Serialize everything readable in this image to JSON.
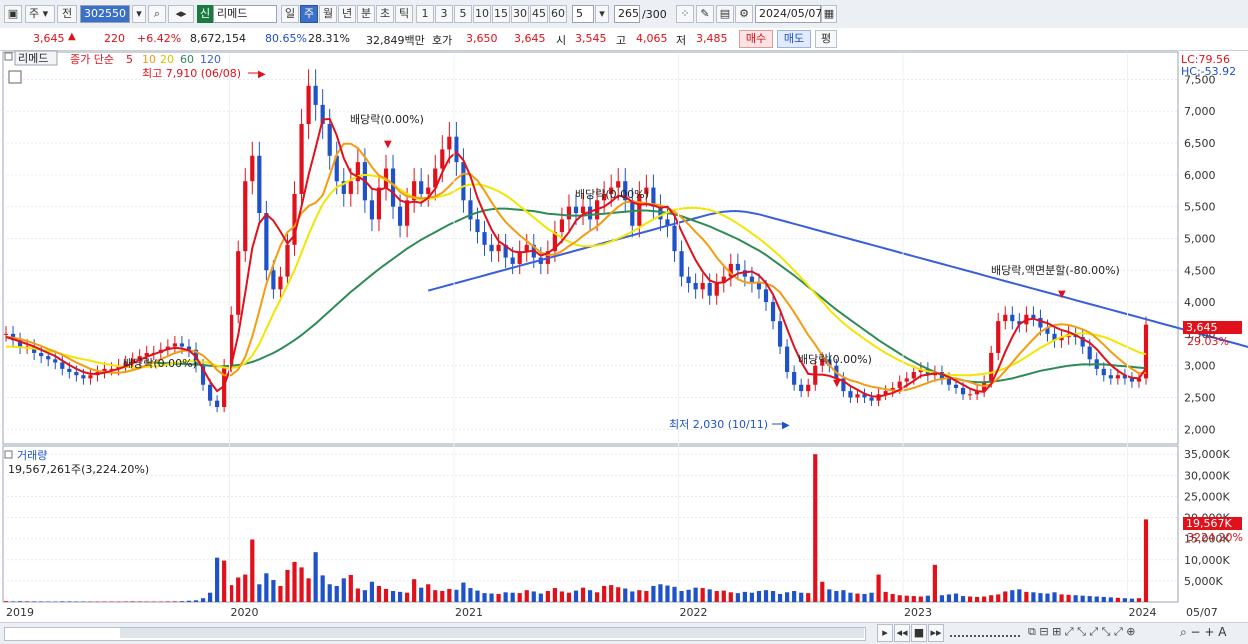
{
  "toolbar": {
    "period_select": "주",
    "prev_label": "전",
    "stock_code": "302550",
    "new_badge": "신",
    "stock_name": "리메드",
    "periods": [
      "일",
      "주",
      "월",
      "년",
      "분",
      "초",
      "틱"
    ],
    "active_period": "주",
    "intervals": [
      "1",
      "3",
      "5",
      "10",
      "15",
      "30",
      "45",
      "60"
    ],
    "interval_value": "5",
    "count_current": "265",
    "count_total": "/300",
    "date": "2024/05/07"
  },
  "quote": {
    "price": "3,645",
    "change": "220",
    "change_pct": "+6.42%",
    "volume": "8,672,154",
    "vol_ratio": "80.65%",
    "turnover_pct": "28.31%",
    "amount": "32,849백만",
    "bid_label": "호가",
    "ask_price": "3,650",
    "bid_price": "3,645",
    "open_label": "시",
    "open": "3,545",
    "high_label": "고",
    "high": "4,065",
    "low_label": "저",
    "low": "3,485",
    "buy_button": "매수",
    "sell_button": "매도",
    "eval_button": "평"
  },
  "price_panel": {
    "stock_tab": "리메드",
    "ma_legend_prefix": "종가 단순",
    "ma_periods": [
      "5",
      "10",
      "20",
      "60",
      "120"
    ],
    "lc_label": "LC:79.56",
    "hc_label": "HC:-53.92",
    "high_annotation": "최고 7,910 (06/08)",
    "low_annotation": "최저 2,030 (10/11)",
    "events": [
      "배당락(0.00%)",
      "배당락(0.00%)",
      "배당락(0.00%)",
      "배당락(0.00%)",
      "배당락,액면분할(-80.00%)"
    ],
    "current_price_tag": "3,645",
    "current_pct_tag": "29.03%"
  },
  "volume_panel": {
    "title": "거래량",
    "summary": "19,567,261주(3,224.20%)",
    "current_tag": "19,567K",
    "current_pct_tag": "3224.20%"
  },
  "colors": {
    "up": "#e0111b",
    "down": "#1f52c8",
    "ma5": "#e0111b",
    "ma10": "#f39c12",
    "ma20": "#f2e600",
    "ma60": "#2e8b57",
    "ma120": "#3a5fd9"
  },
  "chart_data": [
    {
      "type": "candlestick",
      "title": "리메드 (302550) 주봉",
      "x_labels": [
        "2019",
        "2020",
        "2021",
        "2022",
        "2023",
        "2024",
        "05/07"
      ],
      "ylim": [
        1800,
        7900
      ],
      "y_ticks": [
        2000,
        2500,
        3000,
        3500,
        4000,
        4500,
        5000,
        5500,
        6000,
        6500,
        7000,
        7500
      ],
      "y_tick_labels": [
        "2,000",
        "2,500",
        "3,000",
        "3,500",
        "4,000",
        "4,500",
        "5,000",
        "5,500",
        "6,000",
        "6,500",
        "7,000",
        "7,500"
      ],
      "close": [
        3500,
        3400,
        3300,
        3300,
        3200,
        3150,
        3100,
        3050,
        2950,
        2900,
        2850,
        2800,
        2850,
        2900,
        2950,
        2950,
        3000,
        3050,
        3100,
        3150,
        3200,
        3200,
        3250,
        3300,
        3350,
        3300,
        3250,
        3000,
        2700,
        2450,
        2350,
        3000,
        3800,
        4800,
        5900,
        6300,
        5400,
        4500,
        4200,
        4400,
        4900,
        5700,
        6800,
        7400,
        7100,
        6800,
        6300,
        5900,
        5700,
        5900,
        6200,
        5600,
        5300,
        5800,
        6100,
        5500,
        5200,
        5600,
        5900,
        5700,
        5800,
        6100,
        6400,
        6600,
        6200,
        5600,
        5300,
        5100,
        4900,
        4800,
        4900,
        4700,
        4600,
        4800,
        4900,
        4700,
        4600,
        4800,
        5100,
        5300,
        5500,
        5400,
        5500,
        5300,
        5600,
        5700,
        5800,
        5900,
        5600,
        5200,
        5700,
        5800,
        5500,
        5300,
        5200,
        4800,
        4400,
        4300,
        4200,
        4300,
        4100,
        4300,
        4400,
        4600,
        4500,
        4400,
        4300,
        4200,
        4000,
        3700,
        3300,
        2900,
        2700,
        2600,
        2700,
        3000,
        3100,
        3000,
        2800,
        2600,
        2500,
        2550,
        2500,
        2450,
        2550,
        2600,
        2650,
        2750,
        2800,
        2900,
        2950,
        2850,
        2900,
        2800,
        2700,
        2650,
        2550,
        2550,
        2600,
        2750,
        3200,
        3700,
        3800,
        3700,
        3650,
        3800,
        3750,
        3600,
        3500,
        3400,
        3450,
        3500,
        3450,
        3300,
        3100,
        2950,
        2850,
        2800,
        2850,
        2800,
        2750,
        2800,
        3645
      ],
      "ma5": [
        3450,
        3420,
        3380,
        3340,
        3300,
        3250,
        3200,
        3150,
        3080,
        3010,
        2950,
        2900,
        2870,
        2870,
        2890,
        2920,
        2950,
        2990,
        3040,
        3090,
        3140,
        3180,
        3220,
        3260,
        3280,
        3270,
        3240,
        3140,
        2950,
        2750,
        2600,
        2680,
        3000,
        3480,
        4150,
        4850,
        5240,
        5380,
        5280,
        5110,
        4920,
        5050,
        5510,
        6000,
        6420,
        6870,
        6880,
        6620,
        6260,
        6030,
        5970,
        5910,
        5780,
        5760,
        5800,
        5720,
        5600,
        5560,
        5580,
        5560,
        5640,
        5780,
        6040,
        6260,
        6360,
        6230,
        5980,
        5640,
        5380,
        5140,
        4960,
        4880,
        4800,
        4780,
        4790,
        4810,
        4730,
        4770,
        4850,
        4960,
        5100,
        5280,
        5380,
        5420,
        5460,
        5500,
        5580,
        5670,
        5660,
        5570,
        5530,
        5540,
        5520,
        5480,
        5500,
        5360,
        5110,
        4880,
        4660,
        4480,
        4340,
        4300,
        4310,
        4380,
        4450,
        4470,
        4480,
        4420,
        4300,
        4120,
        3870,
        3580,
        3300,
        3060,
        2870,
        2860,
        2860,
        2840,
        2800,
        2760,
        2680,
        2620,
        2560,
        2520,
        2510,
        2540,
        2570,
        2620,
        2690,
        2760,
        2840,
        2860,
        2880,
        2870,
        2820,
        2760,
        2700,
        2640,
        2600,
        2590,
        2710,
        2950,
        3220,
        3450,
        3650,
        3720,
        3740,
        3700,
        3670,
        3610,
        3560,
        3530,
        3480,
        3420,
        3360,
        3260,
        3130,
        3010,
        2920,
        2850,
        2810,
        2800,
        2960
      ],
      "ma10": [
        3450,
        3440,
        3420,
        3390,
        3350,
        3310,
        3260,
        3220,
        3170,
        3110,
        3050,
        3000,
        2950,
        2920,
        2900,
        2890,
        2890,
        2900,
        2930,
        2960,
        3010,
        3050,
        3100,
        3150,
        3200,
        3230,
        3240,
        3220,
        3160,
        3060,
        2930,
        2850,
        2850,
        2940,
        3140,
        3460,
        3860,
        4290,
        4590,
        4890,
        5100,
        5190,
        5400,
        5510,
        5560,
        5680,
        5990,
        6320,
        6490,
        6490,
        6420,
        6280,
        6120,
        5990,
        5940,
        5850,
        5730,
        5660,
        5650,
        5630,
        5640,
        5660,
        5720,
        5820,
        5940,
        6020,
        6010,
        5910,
        5750,
        5570,
        5400,
        5260,
        5150,
        5050,
        4960,
        4870,
        4780,
        4740,
        4750,
        4800,
        4880,
        4950,
        5040,
        5120,
        5190,
        5290,
        5400,
        5500,
        5570,
        5580,
        5570,
        5550,
        5540,
        5520,
        5480,
        5420,
        5330,
        5220,
        5100,
        4990,
        4860,
        4700,
        4570,
        4450,
        4360,
        4310,
        4300,
        4310,
        4290,
        4250,
        4150,
        4000,
        3840,
        3660,
        3480,
        3330,
        3160,
        3010,
        2890,
        2820,
        2770,
        2740,
        2700,
        2670,
        2650,
        2630,
        2610,
        2600,
        2620,
        2650,
        2690,
        2730,
        2770,
        2790,
        2810,
        2800,
        2770,
        2740,
        2700,
        2680,
        2710,
        2800,
        2920,
        3050,
        3180,
        3300,
        3420,
        3530,
        3600,
        3640,
        3650,
        3640,
        3610,
        3570,
        3520,
        3430,
        3330,
        3220,
        3120,
        3030,
        2950,
        2880,
        2890
      ],
      "ma20": [
        3300,
        3300,
        3290,
        3280,
        3270,
        3250,
        3230,
        3210,
        3180,
        3150,
        3120,
        3100,
        3080,
        3050,
        3030,
        3010,
        2990,
        2980,
        2970,
        2970,
        2980,
        2990,
        3000,
        3020,
        3040,
        3060,
        3070,
        3070,
        3060,
        3040,
        3000,
        2970,
        2960,
        2980,
        3040,
        3160,
        3340,
        3580,
        3820,
        4040,
        4270,
        4500,
        4780,
        5060,
        5310,
        5540,
        5690,
        5810,
        5860,
        5920,
        5980,
        6000,
        5990,
        5970,
        5920,
        5850,
        5770,
        5700,
        5640,
        5610,
        5620,
        5640,
        5670,
        5700,
        5760,
        5820,
        5850,
        5850,
        5830,
        5790,
        5740,
        5680,
        5600,
        5510,
        5420,
        5330,
        5240,
        5150,
        5080,
        5010,
        4950,
        4900,
        4880,
        4880,
        4890,
        4910,
        4950,
        5000,
        5050,
        5110,
        5170,
        5240,
        5300,
        5360,
        5410,
        5450,
        5470,
        5480,
        5480,
        5470,
        5450,
        5410,
        5360,
        5300,
        5230,
        5160,
        5080,
        5000,
        4910,
        4820,
        4720,
        4610,
        4500,
        4380,
        4260,
        4130,
        4010,
        3880,
        3770,
        3670,
        3580,
        3500,
        3420,
        3340,
        3270,
        3200,
        3140,
        3080,
        3030,
        2980,
        2940,
        2910,
        2890,
        2870,
        2860,
        2850,
        2850,
        2850,
        2860,
        2870,
        2890,
        2920,
        2960,
        3010,
        3070,
        3140,
        3210,
        3280,
        3340,
        3400,
        3450,
        3480,
        3500,
        3510,
        3500,
        3480,
        3450,
        3410,
        3360,
        3310,
        3260,
        3210,
        3180
      ],
      "ma60": [
        null,
        null,
        null,
        null,
        null,
        null,
        null,
        null,
        null,
        null,
        null,
        null,
        null,
        null,
        null,
        null,
        null,
        null,
        null,
        null,
        3050,
        3050,
        3040,
        3040,
        3030,
        3030,
        3020,
        3020,
        3010,
        3000,
        2990,
        2990,
        3000,
        3010,
        3030,
        3060,
        3100,
        3150,
        3200,
        3260,
        3330,
        3400,
        3480,
        3570,
        3660,
        3760,
        3860,
        3960,
        4060,
        4160,
        4250,
        4340,
        4430,
        4520,
        4600,
        4680,
        4760,
        4840,
        4910,
        4980,
        5040,
        5100,
        5160,
        5220,
        5270,
        5320,
        5370,
        5410,
        5440,
        5460,
        5470,
        5470,
        5460,
        5450,
        5440,
        5430,
        5410,
        5390,
        5380,
        5370,
        5360,
        5360,
        5360,
        5370,
        5380,
        5390,
        5400,
        5410,
        5420,
        5430,
        5440,
        5440,
        5430,
        5420,
        5400,
        5380,
        5350,
        5310,
        5270,
        5230,
        5190,
        5140,
        5090,
        5040,
        4990,
        4930,
        4870,
        4810,
        4740,
        4660,
        4580,
        4500,
        4420,
        4330,
        4240,
        4150,
        4060,
        3970,
        3880,
        3800,
        3720,
        3640,
        3560,
        3480,
        3400,
        3330,
        3260,
        3190,
        3120,
        3060,
        3000,
        2950,
        2900,
        2860,
        2820,
        2790,
        2770,
        2750,
        2740,
        2740,
        2750,
        2760,
        2780,
        2800,
        2830,
        2860,
        2890,
        2920,
        2940,
        2960,
        2980,
        3000,
        3010,
        3020,
        3020,
        3020,
        3020,
        3010,
        3000,
        2990,
        2980,
        2970,
        2960
      ],
      "ma120": [
        null,
        null,
        null,
        null,
        null,
        null,
        null,
        null,
        null,
        null,
        null,
        null,
        null,
        null,
        null,
        null,
        null,
        null,
        null,
        null,
        null,
        null,
        null,
        null,
        null,
        null,
        null,
        null,
        null,
        null,
        null,
        null,
        null,
        null,
        null,
        null,
        null,
        null,
        null,
        null,
        null,
        null,
        null,
        null,
        null,
        null,
        null,
        null,
        null,
        null,
        null,
        null,
        null,
        null,
        null,
        null,
        null,
        null,
        null,
        null,
        4180,
        4210,
        4240,
        4270,
        4300,
        4330,
        4360,
        4390,
        4420,
        4450,
        4480,
        4510,
        4540,
        4570,
        4600,
        4630,
        4660,
        4690,
        4720,
        4750,
        4780,
        4810,
        4840,
        4870,
        4900,
        4930,
        4960,
        4990,
        5020,
        5050,
        5080,
        5110,
        5140,
        5170,
        5200,
        5230,
        5260,
        5290,
        5320,
        5350,
        5380,
        5400,
        5420,
        5430,
        5430,
        5420,
        5400,
        5380,
        5350,
        5320,
        5290,
        5260,
        5230,
        5200,
        5170,
        5140,
        5110,
        5080,
        5050,
        5020,
        4990,
        4960,
        4930,
        4900,
        4870,
        4840,
        4810,
        4780,
        4750,
        4720,
        4690,
        4660,
        4630,
        4600,
        4570,
        4540,
        4510,
        4480,
        4450,
        4420,
        4390,
        4360,
        4330,
        4300,
        4270,
        4240,
        4210,
        4180,
        4150,
        4120,
        4090,
        4060,
        4030,
        4000,
        3970,
        3940,
        3910,
        3880,
        3850,
        3820,
        3790,
        3760,
        3730,
        3700,
        3670,
        3640,
        3610,
        3580,
        3550,
        3520,
        3490,
        3460,
        3430,
        3400,
        3370,
        3340,
        3310,
        3280,
        3250,
        3220,
        3190,
        3160,
        3130
      ]
    },
    {
      "type": "bar",
      "title": "거래량",
      "ylim": [
        0,
        36000
      ],
      "y_ticks": [
        5000,
        10000,
        15000,
        20000,
        25000,
        30000,
        35000
      ],
      "y_tick_labels": [
        "5,000K",
        "10,000K",
        "15,000K",
        "20,000K",
        "25,000K",
        "30,000K",
        "35,000K"
      ],
      "volume_k": [
        200,
        150,
        180,
        160,
        140,
        130,
        120,
        110,
        150,
        140,
        130,
        120,
        110,
        100,
        120,
        110,
        100,
        130,
        150,
        140,
        120,
        110,
        100,
        140,
        160,
        200,
        300,
        400,
        900,
        2200,
        10500,
        9800,
        4000,
        5800,
        6500,
        14800,
        4200,
        6800,
        5200,
        3800,
        7600,
        9500,
        8200,
        5600,
        11800,
        6300,
        4200,
        3800,
        5600,
        6400,
        3200,
        2800,
        4800,
        3800,
        3100,
        2600,
        2400,
        2200,
        5400,
        3400,
        4200,
        2800,
        2600,
        3100,
        2900,
        4600,
        3300,
        2700,
        2100,
        2000,
        1900,
        2300,
        2200,
        2100,
        2800,
        2500,
        2000,
        2600,
        3300,
        2500,
        2200,
        2700,
        3400,
        2800,
        2300,
        3800,
        4000,
        3500,
        3200,
        2500,
        2800,
        2600,
        3800,
        4200,
        3900,
        3600,
        2600,
        2900,
        3400,
        3300,
        3000,
        2600,
        2700,
        2300,
        2100,
        2400,
        2200,
        2600,
        2800,
        2600,
        1900,
        2300,
        2600,
        2200,
        2100,
        35000,
        4800,
        3000,
        2600,
        2800,
        2200,
        2000,
        1900,
        2200,
        6500,
        2400,
        1900,
        1600,
        1500,
        1400,
        1300,
        1500,
        8800,
        1600,
        1800,
        2000,
        1400,
        1300,
        1200,
        1300,
        1600,
        1800,
        2500,
        2800,
        3000,
        2400,
        2300,
        2100,
        2000,
        2300,
        1800,
        1700,
        1600,
        1500,
        1400,
        1300,
        1200,
        1100,
        1000,
        900,
        800,
        900,
        19567
      ]
    }
  ]
}
